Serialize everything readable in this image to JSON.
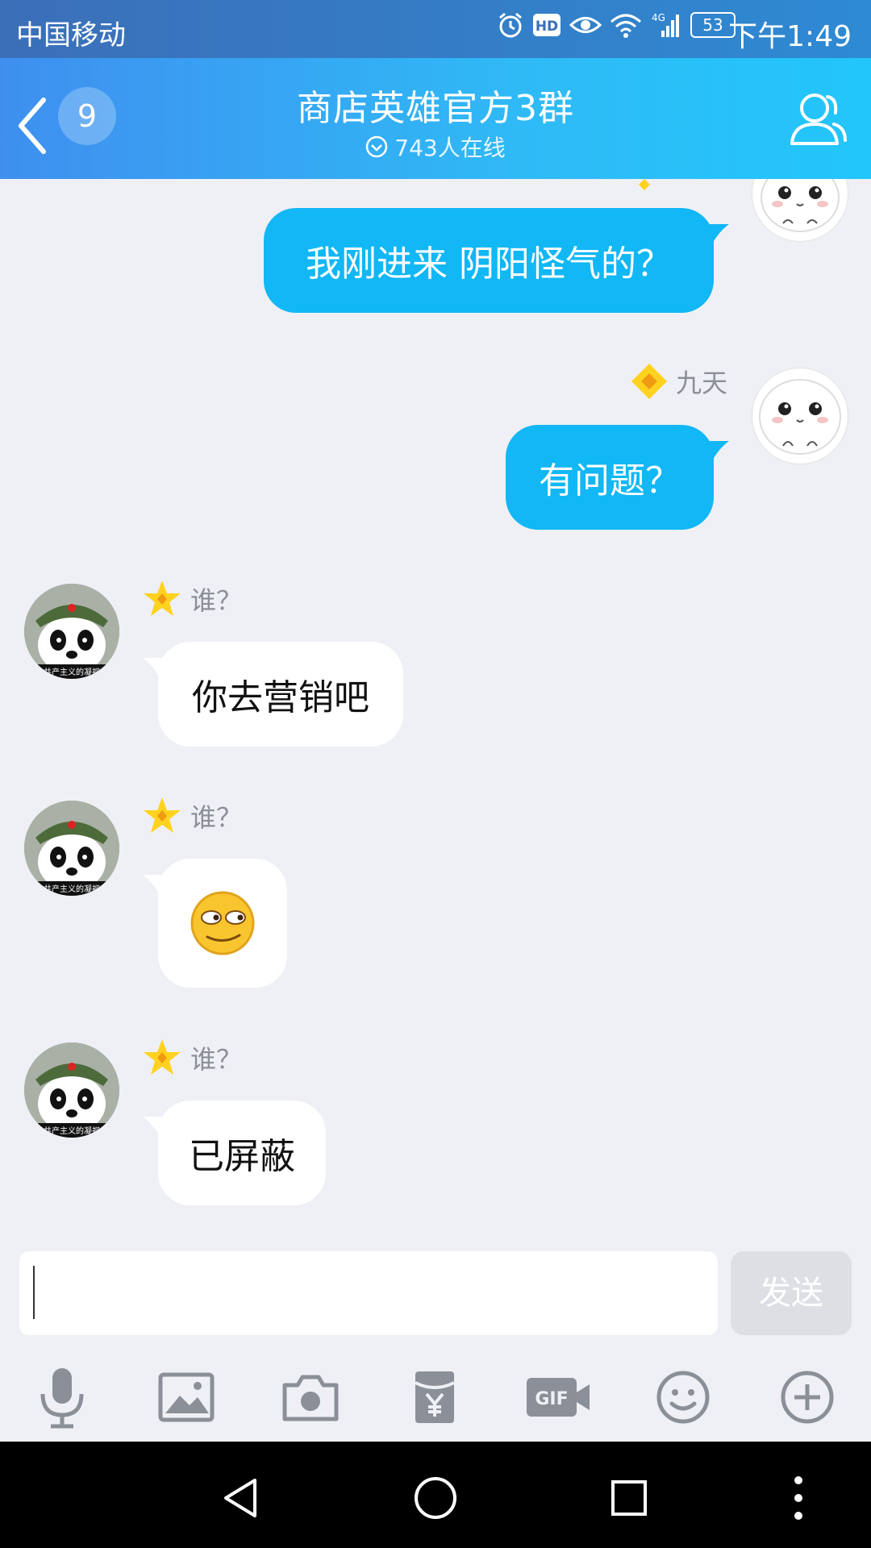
{
  "status_bar": {
    "carrier": "中国移动",
    "hd_label": "HD",
    "network_label": "4G",
    "battery": "53",
    "time": "下午1:49"
  },
  "header": {
    "unread_count": "9",
    "title": "商店英雄官方3群",
    "online": "743人在线"
  },
  "messages": [
    {
      "sender": "",
      "side": "right",
      "text": "我刚进来 阴阳怪气的？"
    },
    {
      "sender": "九天",
      "side": "right",
      "text": "有问题？"
    },
    {
      "sender": "谁？",
      "side": "left",
      "text": "你去营销吧"
    },
    {
      "sender": "谁？",
      "side": "left",
      "emoji": "smirk-emoji"
    },
    {
      "sender": "谁？",
      "side": "left",
      "text": "已屏蔽"
    }
  ],
  "avatar_caption": "共产主义的凝视",
  "composer": {
    "input_value": "",
    "send_label": "发送",
    "gif_label": "GIF",
    "tools": [
      "mic-icon",
      "image-icon",
      "camera-icon",
      "red-packet-icon",
      "gif-icon",
      "emoji-icon",
      "plus-icon"
    ]
  },
  "colors": {
    "header_gradient_start": "#3f8fef",
    "header_gradient_end": "#22c6fb",
    "my_bubble": "#12b7f5",
    "other_bubble": "#ffffff",
    "chat_background": "#eff0f5"
  }
}
